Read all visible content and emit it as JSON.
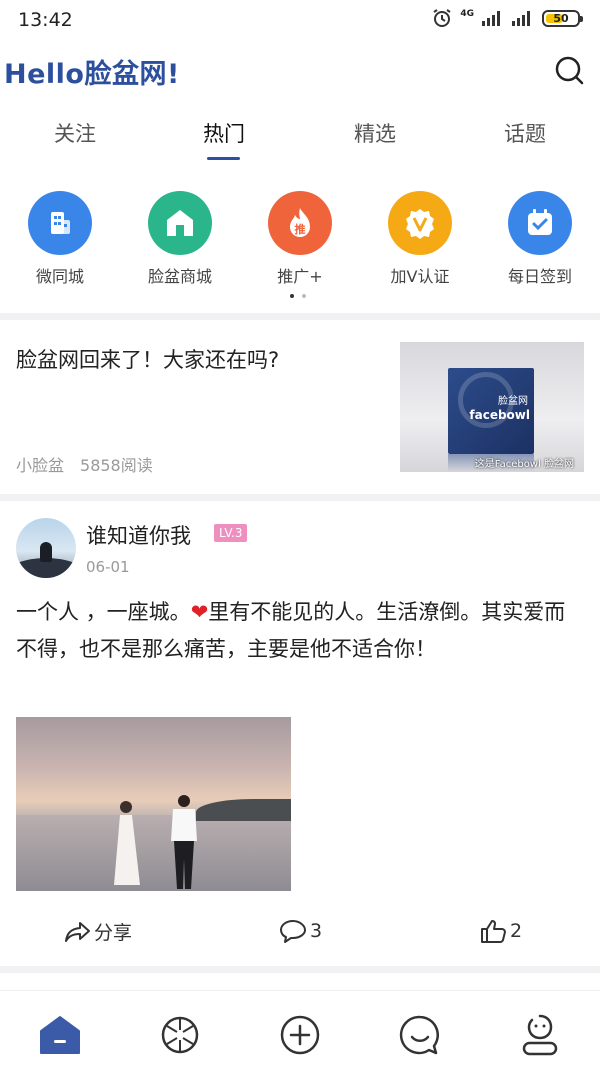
{
  "status_bar": {
    "time": "13:42",
    "network": "4G",
    "battery": "50"
  },
  "header": {
    "title": "Hello脸盆网!"
  },
  "tabs": [
    {
      "label": "关注",
      "active": false
    },
    {
      "label": "热门",
      "active": true
    },
    {
      "label": "精选",
      "active": false
    },
    {
      "label": "话题",
      "active": false
    }
  ],
  "quick_links": [
    {
      "label": "微同城",
      "icon": "building-icon",
      "color": "#3a86e8"
    },
    {
      "label": "脸盆商城",
      "icon": "home-icon",
      "color": "#2bb58a"
    },
    {
      "label": "推广+",
      "icon": "promote-icon",
      "color": "#f0643c"
    },
    {
      "label": "加V认证",
      "icon": "verify-icon",
      "color": "#f5a915"
    },
    {
      "label": "每日签到",
      "icon": "calendar-icon",
      "color": "#3a86e8"
    }
  ],
  "article": {
    "title": "脸盆网回来了！大家还在吗?",
    "author": "小脸盆",
    "reads": "5858阅读",
    "thumb_text_top": "脸盆网",
    "thumb_text_main": "facebowl",
    "thumb_caption": "这是Facebowl 脸盆网"
  },
  "post": {
    "username": "谁知道你我",
    "level": "LV.3",
    "date": "06-01",
    "body_before_heart": "一个人 ，一座城。",
    "body_after_heart": "里有不能见的人。生活潦倒。其实爱而不得，也不是那么痛苦，主要是他不适合你！",
    "share_label": "分享",
    "comment_count": "3",
    "like_count": "2"
  },
  "bottom_nav": [
    {
      "name": "home",
      "icon": "home-icon",
      "active": true
    },
    {
      "name": "discover",
      "icon": "discover-icon",
      "active": false
    },
    {
      "name": "publish",
      "icon": "add-icon",
      "active": false
    },
    {
      "name": "messages",
      "icon": "message-icon",
      "active": false
    },
    {
      "name": "profile",
      "icon": "profile-icon",
      "active": false
    }
  ],
  "colors": {
    "brand": "#2c4f9e",
    "level_badge": "#ef8fc0"
  }
}
